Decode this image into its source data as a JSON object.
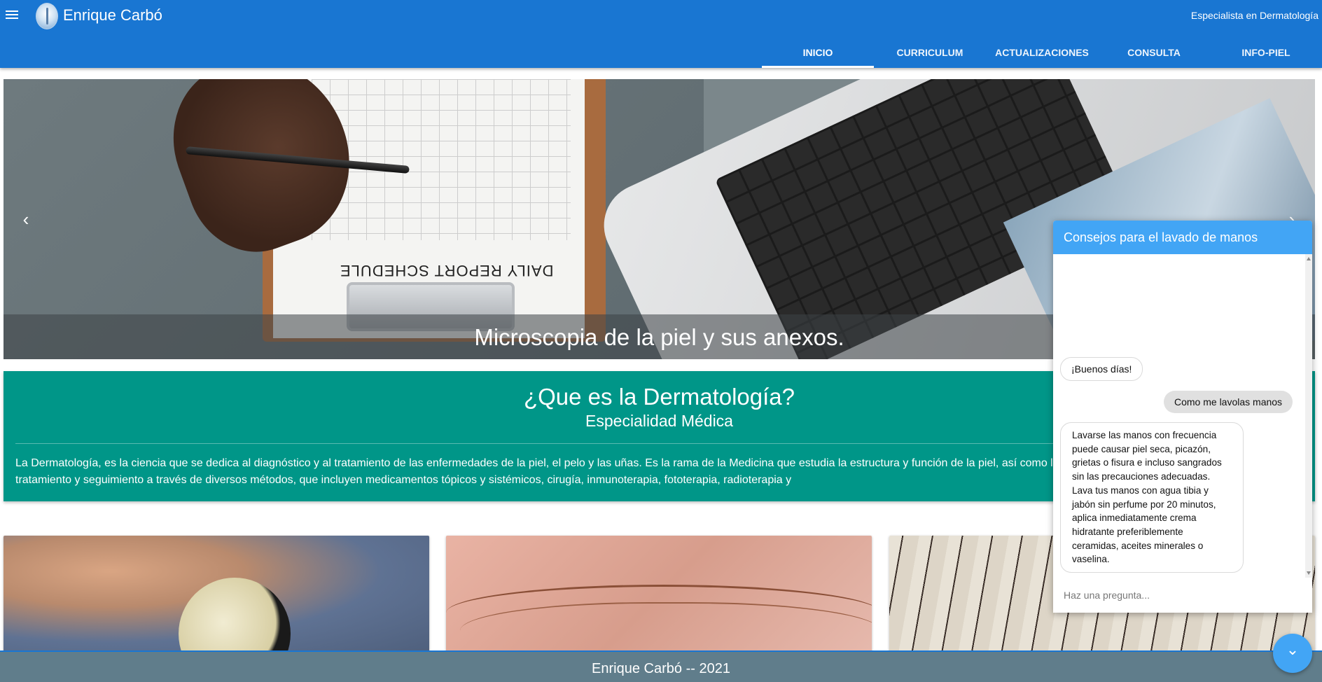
{
  "header": {
    "site_title": "Enrique Carbó",
    "specialist_label": "Especialista en Dermatología",
    "tabs": [
      {
        "label": "INICIO",
        "active": true
      },
      {
        "label": "CURRICULUM",
        "active": false
      },
      {
        "label": "ACTUALIZACIONES",
        "active": false
      },
      {
        "label": "CONSULTA",
        "active": false
      },
      {
        "label": "INFO-PIEL",
        "active": false
      }
    ],
    "colors": {
      "primary": "#1976d2"
    }
  },
  "carousel": {
    "caption": "Microscopia de la piel y sus anexos.",
    "paper_heading": "DAILY REPORT SCHEDULE",
    "prev_icon": "chevron-left-icon",
    "next_icon": "chevron-right-icon"
  },
  "info_card": {
    "title": "¿Que es la Dermatología?",
    "subtitle": "Especialidad Médica",
    "text": "La Dermatología, es la ciencia que se dedica al diagnóstico y al tratamiento de las enfermedades de la piel, el pelo y las uñas. Es la rama de la Medicina que estudia la estructura y función de la piel, así como las enfermedades y sindromes, les ofrece tratamiento y seguimiento a través de diversos métodos, que incluyen medicamentos tópicos y sistémicos, cirugía, inmunoterapia, fototerapia, radioterapia y",
    "color": "#009688"
  },
  "footer": {
    "text": "Enrique Carbó -- 2021",
    "color": "#607d8b"
  },
  "chat": {
    "title": "Consejos para el lavado de manos",
    "messages": [
      {
        "from": "bot",
        "text": "¡Buenos días!"
      },
      {
        "from": "user",
        "text": "Como me lavolas manos"
      },
      {
        "from": "bot",
        "text": "Lavarse las manos con frecuencia puede causar piel seca, picazón, grietas o fisura e incluso sangrados sin las precauciones adecuadas. Lava tus manos con agua tibia y jabón sin perfume por 20 minutos, aplica inmediatamente crema hidratante preferiblemente ceramidas, aceites minerales o vaselina."
      }
    ],
    "input_placeholder": "Haz una pregunta...",
    "header_color": "#42a5f5",
    "toggle_icon": "chevron-down-icon"
  }
}
